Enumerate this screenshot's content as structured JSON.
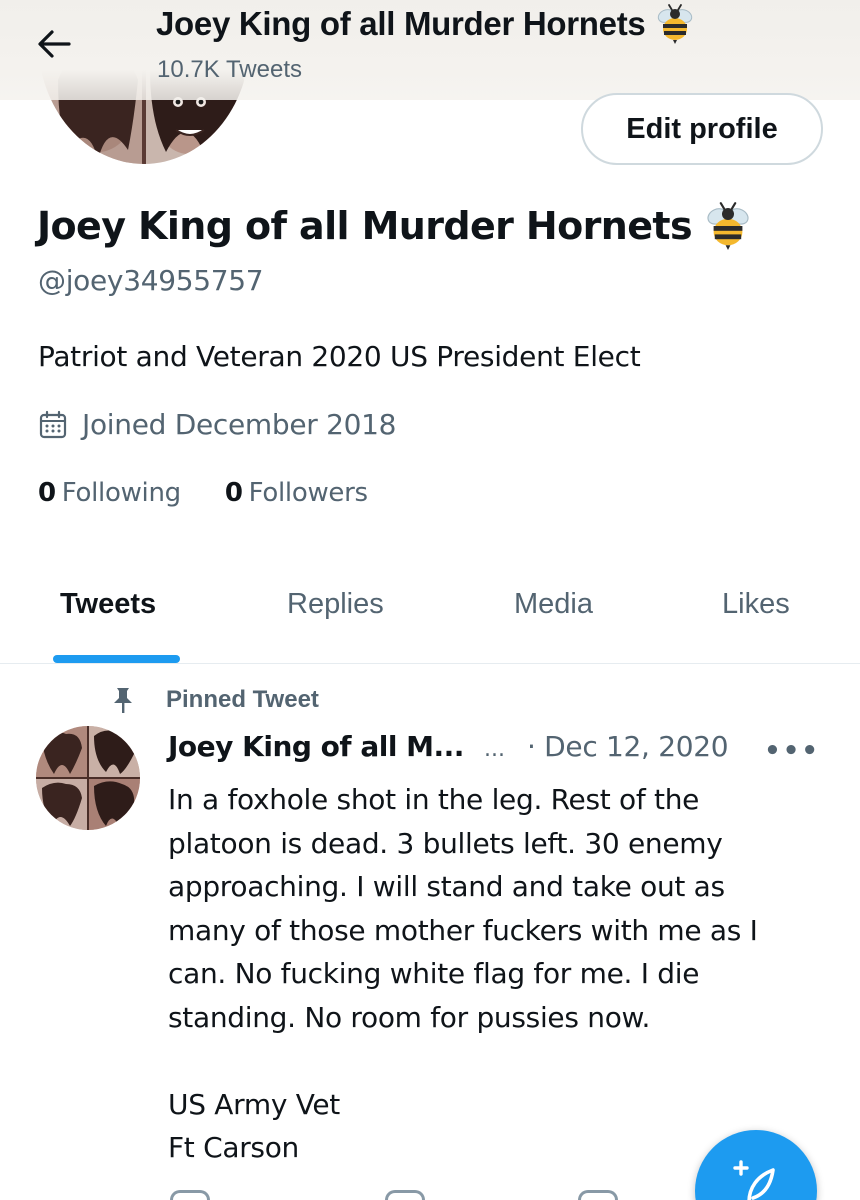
{
  "topbar": {
    "title": "Joey King of all Murder Hornets",
    "tweet_count": "10.7K Tweets"
  },
  "profile": {
    "edit_label": "Edit profile",
    "display_name": "Joey King of all Murder Hornets",
    "handle": "@joey34955757",
    "bio": "Patriot and Veteran 2020 US President Elect",
    "joined": "Joined December 2018",
    "following_count": "0",
    "following_label": "Following",
    "followers_count": "0",
    "followers_label": "Followers"
  },
  "tabs": [
    {
      "label": "Tweets",
      "active": true
    },
    {
      "label": "Replies",
      "active": false
    },
    {
      "label": "Media",
      "active": false
    },
    {
      "label": "Likes",
      "active": false
    }
  ],
  "pinned_tweet": {
    "pinned_label": "Pinned Tweet",
    "author": "Joey King of all M...",
    "ellipsis": "...",
    "date": "· Dec 12, 2020",
    "more": "•••",
    "lines": [
      "In a foxhole shot in the leg. Rest of the",
      "platoon is dead. 3 bullets left. 30 enemy",
      "approaching.  I will stand and take out as",
      "many of those mother fuckers with me as I",
      "can.  No fucking white flag for me. I die",
      "standing. No room for pussies now.",
      "",
      "US Army Vet",
      "Ft Carson"
    ]
  },
  "icons": {
    "back": "arrow-left-icon",
    "bee": "bee-emoji-icon",
    "calendar": "calendar-icon",
    "pin": "pin-icon",
    "compose": "compose-tweet-icon"
  },
  "colors": {
    "accent": "#1d9bf0",
    "secondary_text": "#536471",
    "primary_text": "#0f1419",
    "border": "#cfd9de"
  }
}
